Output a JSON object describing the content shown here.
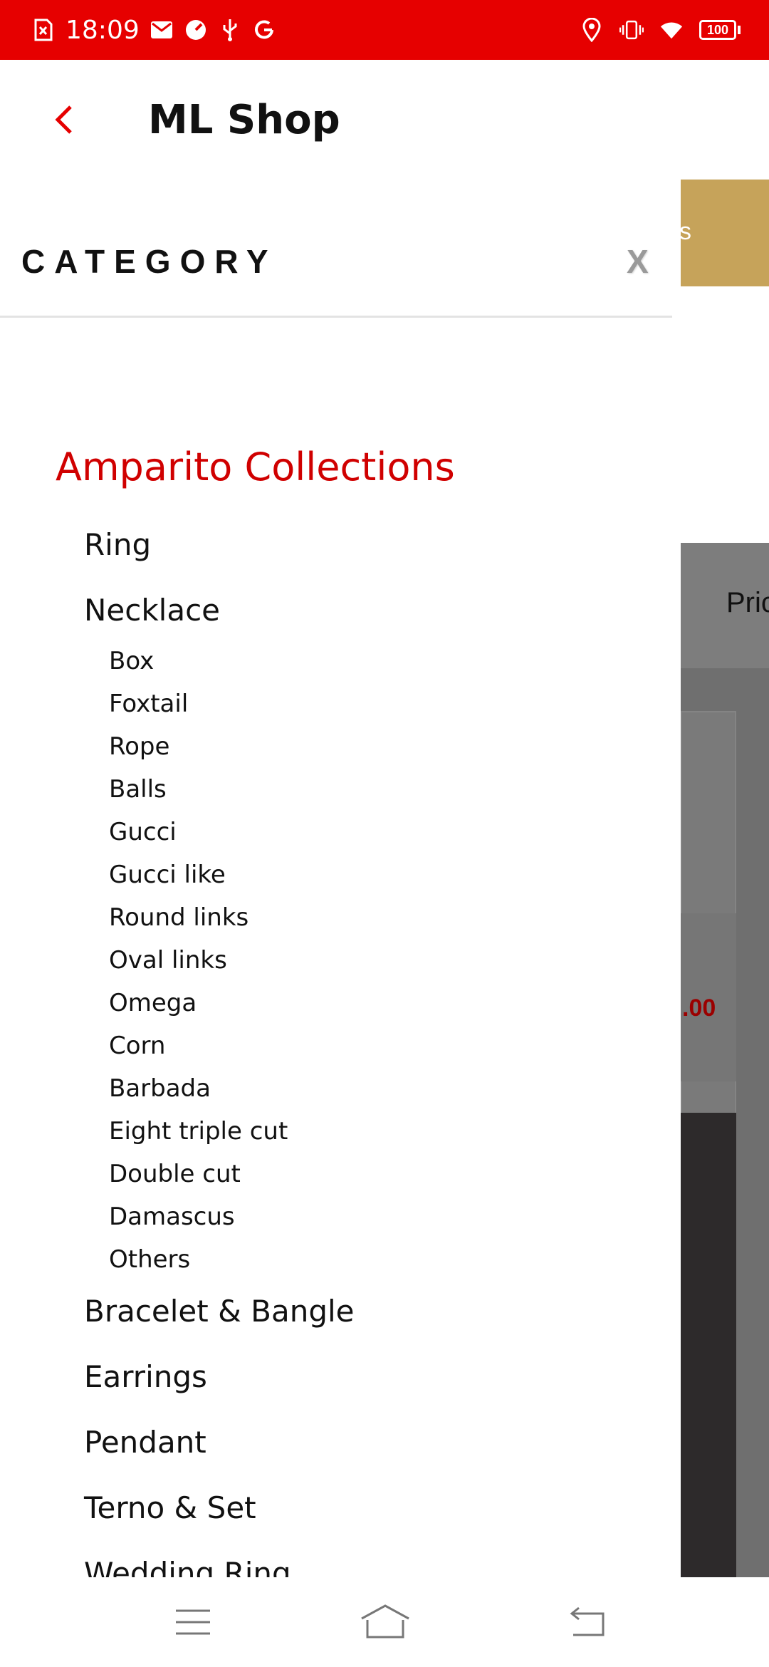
{
  "status_bar": {
    "time": "18:09",
    "battery": "100",
    "icons_left": [
      "sim-error-icon",
      "mail-icon",
      "speed-icon",
      "usb-icon",
      "google-icon"
    ],
    "icons_right": [
      "location-icon",
      "vibrate-icon",
      "wifi-icon",
      "battery-icon"
    ]
  },
  "app_bar": {
    "title": "ML Shop"
  },
  "background": {
    "banner_fragment": "s",
    "sort_fragment": "Pric",
    "price_fragment": ".00"
  },
  "drawer": {
    "title": "CATEGORY",
    "close_label": "X",
    "collection": "Amparito Collections",
    "items": [
      {
        "label": "Ring",
        "level": 1
      },
      {
        "label": "Necklace",
        "level": 1
      },
      {
        "label": "Box",
        "level": 2
      },
      {
        "label": "Foxtail",
        "level": 2
      },
      {
        "label": "Rope",
        "level": 2
      },
      {
        "label": "Balls",
        "level": 2
      },
      {
        "label": "Gucci",
        "level": 2
      },
      {
        "label": "Gucci like",
        "level": 2
      },
      {
        "label": "Round links",
        "level": 2
      },
      {
        "label": "Oval links",
        "level": 2
      },
      {
        "label": "Omega",
        "level": 2
      },
      {
        "label": "Corn",
        "level": 2
      },
      {
        "label": "Barbada",
        "level": 2
      },
      {
        "label": "Eight triple cut",
        "level": 2
      },
      {
        "label": "Double cut",
        "level": 2
      },
      {
        "label": "Damascus",
        "level": 2
      },
      {
        "label": "Others",
        "level": 2
      },
      {
        "label": "Bracelet & Bangle",
        "level": 1
      },
      {
        "label": "Earrings",
        "level": 1
      },
      {
        "label": "Pendant",
        "level": 1
      },
      {
        "label": "Terno & Set",
        "level": 1
      },
      {
        "label": "Wedding Ring",
        "level": 1
      }
    ]
  },
  "colors": {
    "status_bar": "#e60000",
    "accent": "#d00000",
    "gold": "#c6a35a"
  },
  "nav_bar": {
    "icons": [
      "menu-icon",
      "home-icon",
      "back-icon"
    ]
  }
}
